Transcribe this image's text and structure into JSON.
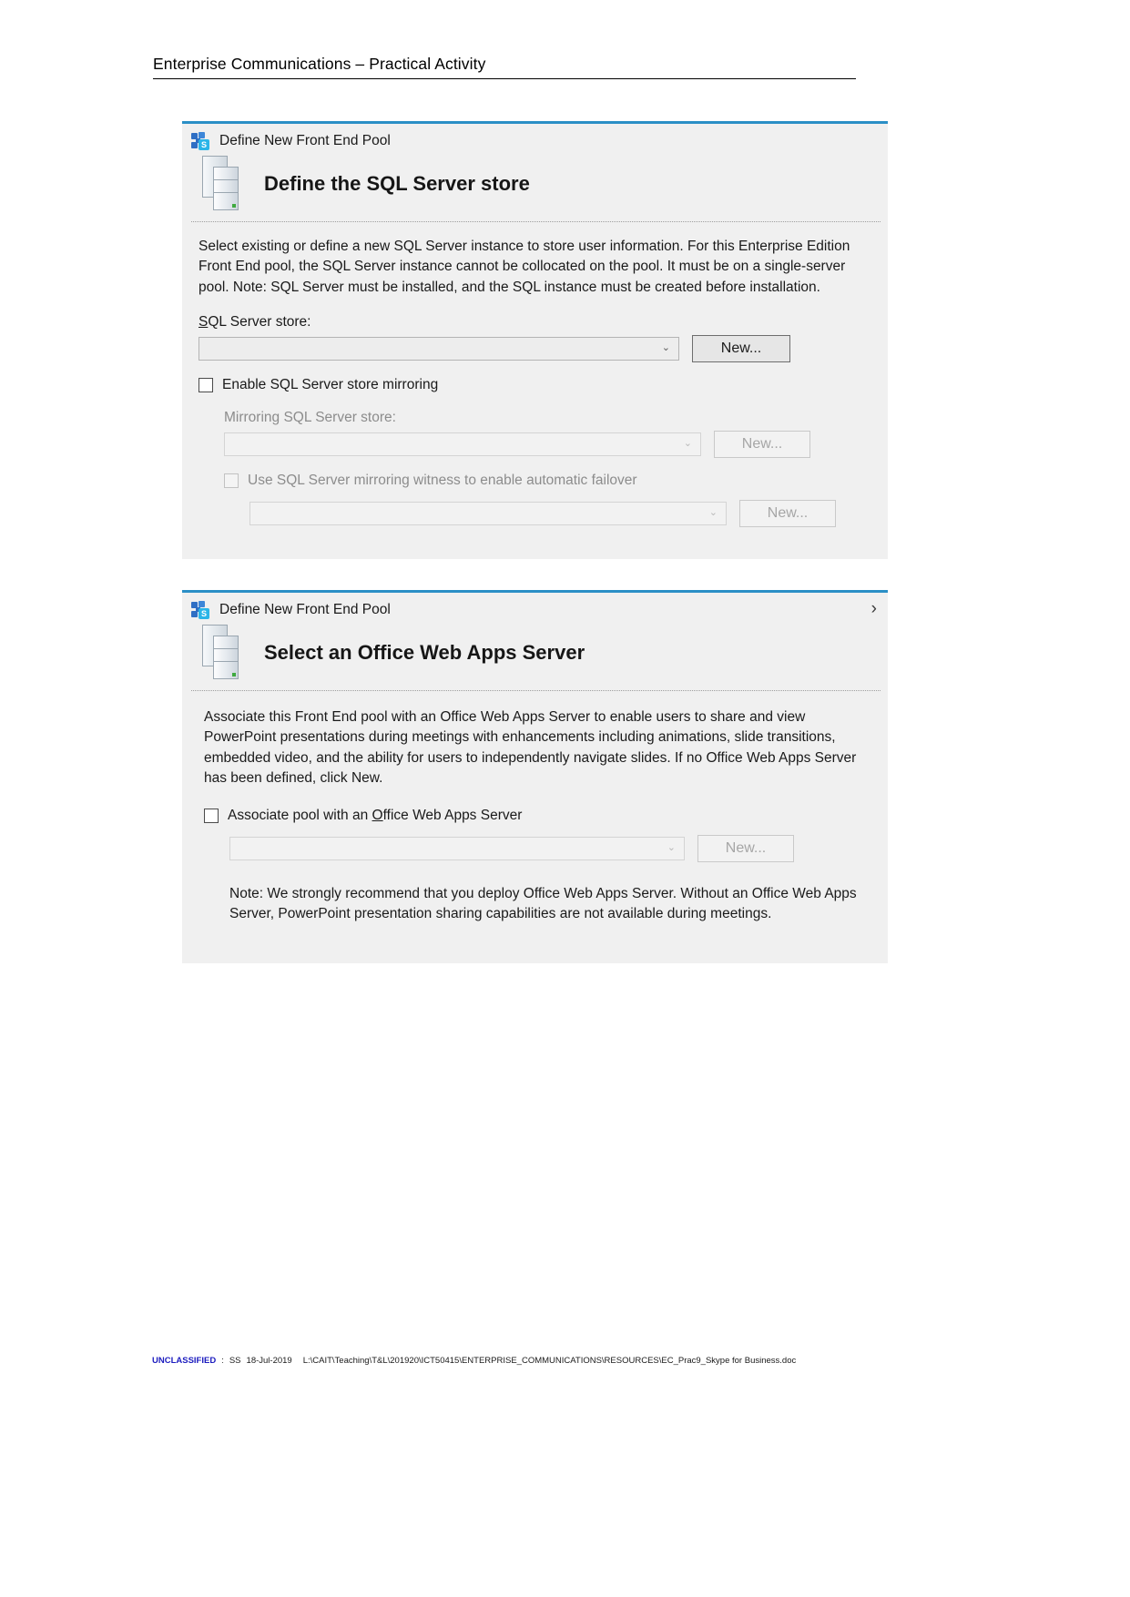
{
  "page": {
    "header_title": "Enterprise Communications – Practical Activity"
  },
  "dialog_sql": {
    "app_icon": "skype-for-business-icon",
    "window_title": "Define New Front End Pool",
    "heading_icon": "sql-server-store-icon",
    "heading": "Define the SQL Server store",
    "description_lines": [
      "Select existing or define a new SQL Server instance to store user information.  For this Enterprise Edition",
      "Front End pool, the SQL Server instance cannot be collocated on the pool. It must be on a single-server",
      "pool.  Note: SQL Server must be installed, and the SQL instance must be created before installation."
    ],
    "sql_store_label": "SQL Server store:",
    "sql_store_value": "",
    "sql_store_new_button": "New...",
    "mirroring_checkbox_label": "Enable SQL Server store mirroring",
    "mirroring_checkbox_checked": false,
    "mirroring_store_label": "Mirroring SQL Server store:",
    "mirroring_store_value": "",
    "mirroring_new_button": "New...",
    "witness_checkbox_label": "Use SQL Server mirroring witness to enable automatic failover",
    "witness_checkbox_checked": false,
    "witness_store_value": "",
    "witness_new_button": "New...",
    "dropdown_arrow_glyph": "⌄"
  },
  "dialog_owas": {
    "app_icon": "skype-for-business-icon",
    "window_title": "Define New Front End Pool",
    "chevron_glyph": "›",
    "heading_icon": "office-web-apps-server-icon",
    "heading": "Select an Office Web Apps Server",
    "description_lines": [
      "Associate this Front End pool with an Office Web Apps Server to enable users to share and view",
      "PowerPoint presentations during meetings with enhancements including animations, slide transitions,",
      "embedded video, and the ability for users to independently navigate slides. If no Office Web Apps Server",
      "has been defined, click New."
    ],
    "associate_checkbox_label": "Associate pool with an Office Web Apps Server",
    "associate_checkbox_checked": false,
    "associate_store_value": "",
    "associate_new_button": "New...",
    "note_lines": [
      "Note: We strongly recommend that you deploy Office Web Apps Server. Without an Office Web Apps",
      "Server, PowerPoint presentation sharing capabilities are not available during meetings."
    ],
    "dropdown_arrow_glyph": "⌄"
  },
  "footer": {
    "classification": "UNCLASSIFIED",
    "separator": ":",
    "initials": "SS",
    "date": "18-Jul-2019",
    "path": "L:\\CAIT\\Teaching\\T&L\\201920\\ICT50415\\ENTERPRISE_COMMUNICATIONS\\RESOURCES\\EC_Prac9_Skype for Business.doc"
  },
  "colors": {
    "accent_blue": "#2b8fc6",
    "dialog_bg": "#f0f0f0",
    "classification": "#1d1dbf"
  }
}
